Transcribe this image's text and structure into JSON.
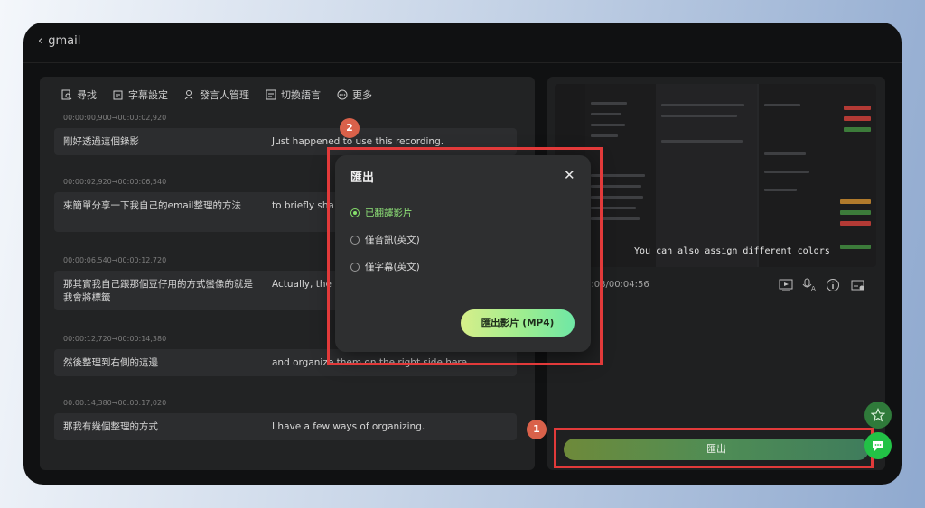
{
  "window": {
    "back_label": "gmail"
  },
  "toolbar": {
    "items": [
      {
        "label": "尋找",
        "icon": "search-doc-icon"
      },
      {
        "label": "字幕設定",
        "icon": "caption-settings-icon"
      },
      {
        "label": "發言人管理",
        "icon": "speaker-manage-icon"
      },
      {
        "label": "切換語言",
        "icon": "switch-language-icon"
      },
      {
        "label": "更多",
        "icon": "more-icon"
      }
    ]
  },
  "segments": [
    {
      "time": "00:00:00,900→00:00:02,920",
      "zh": "剛好透過這個錄影",
      "en": "Just happened to use this recording."
    },
    {
      "time": "00:00:02,920→00:00:06,540",
      "zh": "來簡單分享一下我自己的email整理的方法",
      "en": "to briefly sha method."
    },
    {
      "time": "00:00:06,540→00:00:12,720",
      "zh": "那其實我自己跟那個豆仔用的方式蠻像的就是我會將標籤",
      "en": "Actually, the w similar to wha"
    },
    {
      "time": "00:00:12,720→00:00:14,380",
      "zh": "然後整理到右側的這邊",
      "en": "and organize them on the right side here."
    },
    {
      "time": "00:00:14,380→00:00:17,020",
      "zh": "那我有幾個整理的方式",
      "en": "I have a few ways of organizing."
    }
  ],
  "video": {
    "caption": "You can also assign different colors",
    "time_readout": "0:08/00:04:56"
  },
  "export_button": "匯出",
  "dialog": {
    "title": "匯出",
    "options": [
      {
        "label": "已翻譯影片",
        "selected": true
      },
      {
        "label": "僅音訊(英文)",
        "selected": false
      },
      {
        "label": "僅字幕(英文)",
        "selected": false
      }
    ],
    "export_mp4": "匯出影片 (MP4)"
  },
  "annotations": {
    "badge_1": "1",
    "badge_2": "2",
    "color": "#e23a3a"
  },
  "colors": {
    "accent_green": "#86e06b",
    "badge": "#d9614a"
  }
}
